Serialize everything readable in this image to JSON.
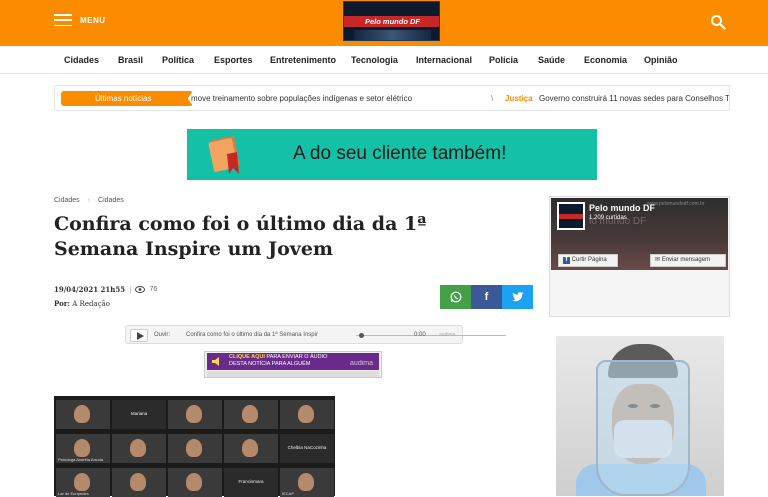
{
  "header": {
    "menu_label": "MENU",
    "logo_text": "Pelo mundo DF",
    "search_icon": "search-icon",
    "bar_color": "#fb8c00"
  },
  "nav": {
    "items": [
      "Cidades",
      "Brasil",
      "Política",
      "Esportes",
      "Entretenimento",
      "Tecnologia",
      "Internacional",
      "Polícia",
      "Saúde",
      "Economia",
      "Opinião"
    ]
  },
  "ticker": {
    "label": "Últimas notícias",
    "text1": "move treinamento sobre populações indígenas e setor elétrico",
    "sep": "\\",
    "category": "Justiça",
    "text2": "Governo construirá 11 novas sedes para Conselhos Tutelares",
    "sep2": "\\"
  },
  "banner": {
    "text": "A do seu cliente também!",
    "color": "#14c1a6"
  },
  "article": {
    "breadcrumb": [
      "Cidades",
      "Cidades"
    ],
    "breadcrumb_sep": "›",
    "title": "Confira como foi o último dia da 1ª Semana Inspire um Jovem",
    "date": "19/04/2021 21h55",
    "meta_sep": "|",
    "views": "76",
    "author_label": "Por:",
    "author": "A Redação"
  },
  "share": {
    "whatsapp_color": "#43a047",
    "facebook_color": "#3b5998",
    "twitter_color": "#1da1f2"
  },
  "player": {
    "label": "Ouvir:",
    "title": "Confira como foi o último dia da 1ª Semana Inspir",
    "time": "0:00",
    "brand": "audima"
  },
  "audio_ad": {
    "highlight": "CLIQUE AQUI",
    "text1": "PARA ENVIAR O ÁUDIO",
    "text2": "DESTA NOTÍCIA PARA ALGUÉM",
    "brand": "audima"
  },
  "video": {
    "tiles": [
      {
        "label": "",
        "type": "face"
      },
      {
        "label": "Mariana",
        "type": "name"
      },
      {
        "label": "",
        "type": "face"
      },
      {
        "label": "",
        "type": "face"
      },
      {
        "label": "",
        "type": "face"
      },
      {
        "label": "Psicóloga Andréia Arruda",
        "type": "face"
      },
      {
        "label": "",
        "type": "face"
      },
      {
        "label": "",
        "type": "face"
      },
      {
        "label": "",
        "type": "face"
      },
      {
        "label": "Chelbia NaCozinha",
        "type": "name"
      },
      {
        "label": "Lar de Eurípedes",
        "type": "face"
      },
      {
        "label": "",
        "type": "face"
      },
      {
        "label": "",
        "type": "face"
      },
      {
        "label": "Francismara",
        "type": "name"
      },
      {
        "label": "IECAP",
        "type": "face"
      }
    ]
  },
  "facebook": {
    "url": "www.pelomundodf.com.br",
    "name": "Pelo mundo DF",
    "likes": "1.209 curtidas",
    "watermark": "lo mundo DF",
    "like_button": "Curtir Página",
    "message_button": "Enviar mensagem"
  }
}
